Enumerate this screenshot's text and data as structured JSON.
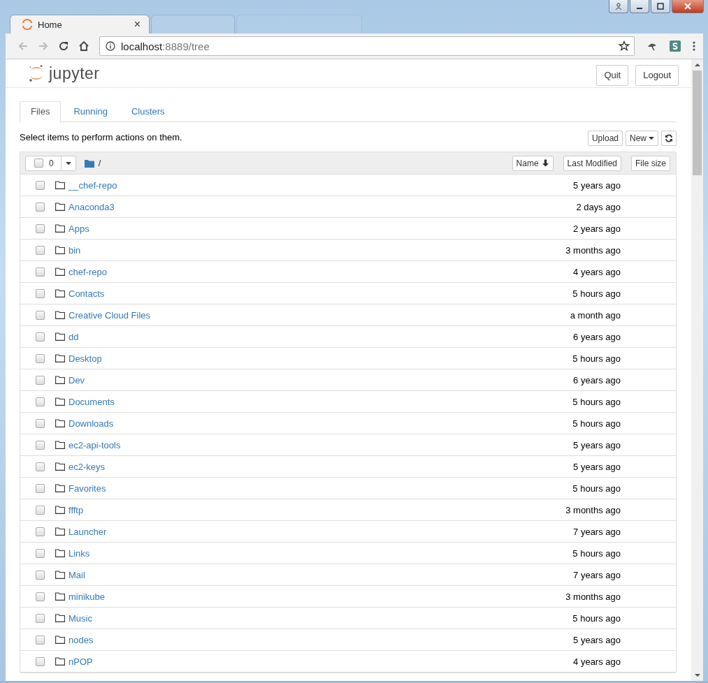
{
  "browser": {
    "tabs": [
      {
        "title": "Home",
        "close": "×",
        "selected": true
      },
      {
        "selected": false
      },
      {
        "selected": false
      }
    ],
    "address": {
      "host": "localhost",
      "rest": ":8889/tree"
    }
  },
  "header": {
    "logo": "jupyter",
    "buttons": [
      "Quit",
      "Logout"
    ]
  },
  "tabs": [
    {
      "label": "Files",
      "selected": true
    },
    {
      "label": "Running",
      "selected": false
    },
    {
      "label": "Clusters",
      "selected": false
    }
  ],
  "hint": "Select items to perform actions on them.",
  "actions": {
    "upload": "Upload",
    "new": "New"
  },
  "list_header": {
    "all_checked": false,
    "selected_count": "0",
    "path": "/",
    "columns": [
      "Name",
      "Last Modified",
      "File size"
    ]
  },
  "rows": [
    {
      "name": "__chef-repo",
      "modified": "5 years ago",
      "checked": false
    },
    {
      "name": "Anaconda3",
      "modified": "2 days ago",
      "checked": false
    },
    {
      "name": "Apps",
      "modified": "2 years ago",
      "checked": false
    },
    {
      "name": "bin",
      "modified": "3 months ago",
      "checked": false
    },
    {
      "name": "chef-repo",
      "modified": "4 years ago",
      "checked": false
    },
    {
      "name": "Contacts",
      "modified": "5 hours ago",
      "checked": false
    },
    {
      "name": "Creative Cloud Files",
      "modified": "a month ago",
      "checked": false
    },
    {
      "name": "dd",
      "modified": "6 years ago",
      "checked": false
    },
    {
      "name": "Desktop",
      "modified": "5 hours ago",
      "checked": false
    },
    {
      "name": "Dev",
      "modified": "6 years ago",
      "checked": false
    },
    {
      "name": "Documents",
      "modified": "5 hours ago",
      "checked": false
    },
    {
      "name": "Downloads",
      "modified": "5 hours ago",
      "checked": false
    },
    {
      "name": "ec2-api-tools",
      "modified": "5 years ago",
      "checked": false
    },
    {
      "name": "ec2-keys",
      "modified": "5 years ago",
      "checked": false
    },
    {
      "name": "Favorites",
      "modified": "5 hours ago",
      "checked": false
    },
    {
      "name": "ffftp",
      "modified": "3 months ago",
      "checked": false
    },
    {
      "name": "Launcher",
      "modified": "7 years ago",
      "checked": false
    },
    {
      "name": "Links",
      "modified": "5 hours ago",
      "checked": false
    },
    {
      "name": "Mail",
      "modified": "7 years ago",
      "checked": false
    },
    {
      "name": "minikube",
      "modified": "3 months ago",
      "checked": false
    },
    {
      "name": "Music",
      "modified": "5 hours ago",
      "checked": false
    },
    {
      "name": "nodes",
      "modified": "5 years ago",
      "checked": false
    },
    {
      "name": "nPOP",
      "modified": "4 years ago",
      "checked": false
    }
  ]
}
